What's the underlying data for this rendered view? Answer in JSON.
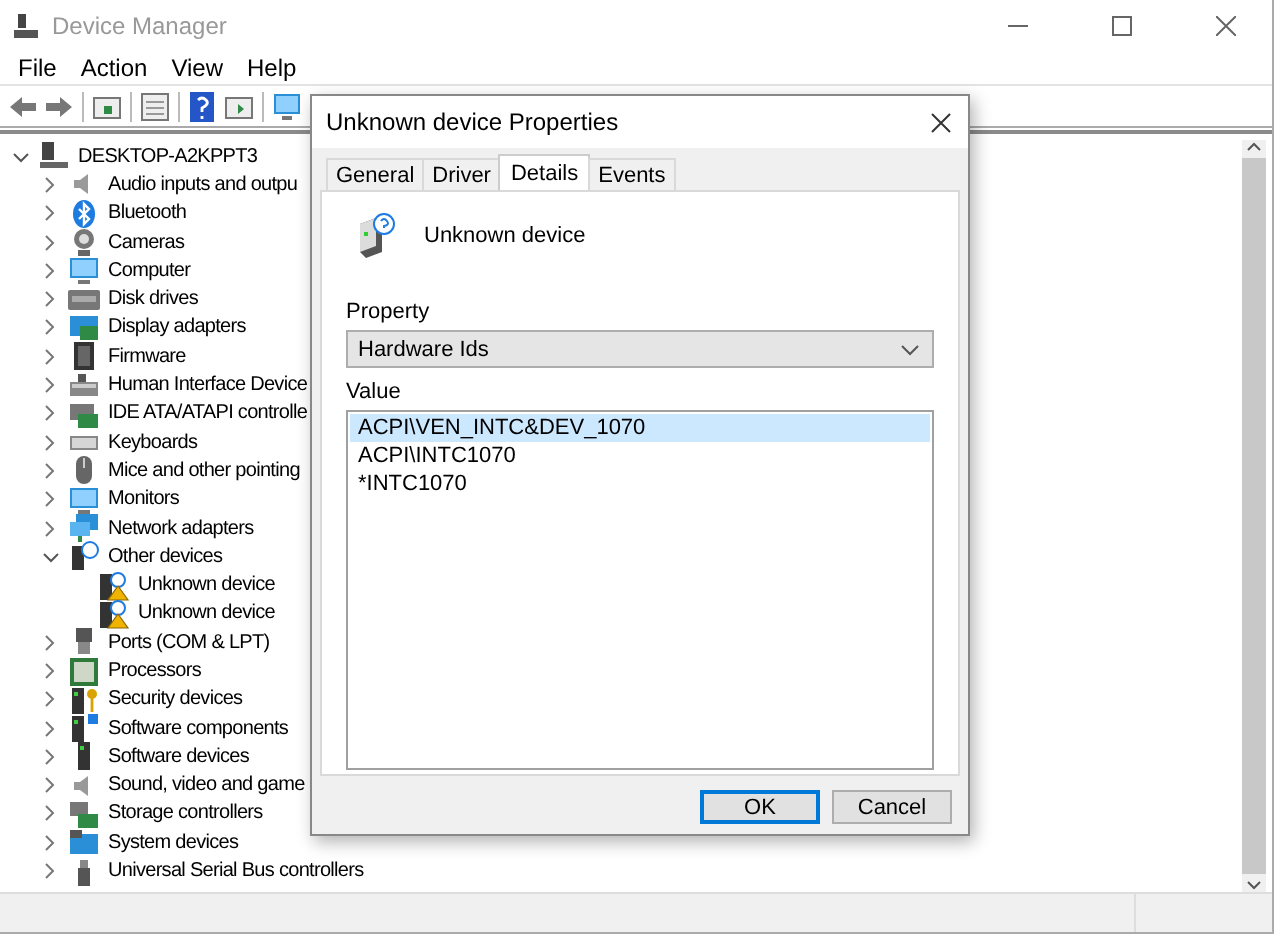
{
  "window": {
    "title": "Device Manager"
  },
  "menu": [
    "File",
    "Action",
    "View",
    "Help"
  ],
  "tree": {
    "label": "DESKTOP-A2KPPT3",
    "expanded": true,
    "children": [
      {
        "label": "Audio inputs and outpu",
        "expanded": false
      },
      {
        "label": "Bluetooth",
        "expanded": false
      },
      {
        "label": "Cameras",
        "expanded": false
      },
      {
        "label": "Computer",
        "expanded": false
      },
      {
        "label": "Disk drives",
        "expanded": false
      },
      {
        "label": "Display adapters",
        "expanded": false
      },
      {
        "label": "Firmware",
        "expanded": false
      },
      {
        "label": "Human Interface Device",
        "expanded": false
      },
      {
        "label": "IDE ATA/ATAPI controlle",
        "expanded": false
      },
      {
        "label": "Keyboards",
        "expanded": false
      },
      {
        "label": "Mice and other pointing",
        "expanded": false
      },
      {
        "label": "Monitors",
        "expanded": false
      },
      {
        "label": "Network adapters",
        "expanded": false
      },
      {
        "label": "Other devices",
        "expanded": true,
        "children": [
          {
            "label": "Unknown device"
          },
          {
            "label": "Unknown device"
          }
        ]
      },
      {
        "label": "Ports (COM & LPT)",
        "expanded": false
      },
      {
        "label": "Processors",
        "expanded": false
      },
      {
        "label": "Security devices",
        "expanded": false
      },
      {
        "label": "Software components",
        "expanded": false
      },
      {
        "label": "Software devices",
        "expanded": false
      },
      {
        "label": "Sound, video and game",
        "expanded": false
      },
      {
        "label": "Storage controllers",
        "expanded": false
      },
      {
        "label": "System devices",
        "expanded": false
      },
      {
        "label": "Universal Serial Bus controllers",
        "expanded": false
      }
    ]
  },
  "dialog": {
    "title": "Unknown device Properties",
    "tabs": [
      {
        "label": "General",
        "selected": false
      },
      {
        "label": "Driver",
        "selected": false
      },
      {
        "label": "Details",
        "selected": true
      },
      {
        "label": "Events",
        "selected": false
      }
    ],
    "device_name": "Unknown device",
    "property_label": "Property",
    "property": "Hardware Ids",
    "value_label": "Value",
    "values": [
      {
        "text": "ACPI\\VEN_INTC&DEV_1070",
        "selected": true
      },
      {
        "text": "ACPI\\INTC1070",
        "selected": false
      },
      {
        "text": "*INTC1070",
        "selected": false
      }
    ],
    "buttons": [
      {
        "label": "OK",
        "default": true
      },
      {
        "label": "Cancel",
        "default": false
      }
    ]
  }
}
